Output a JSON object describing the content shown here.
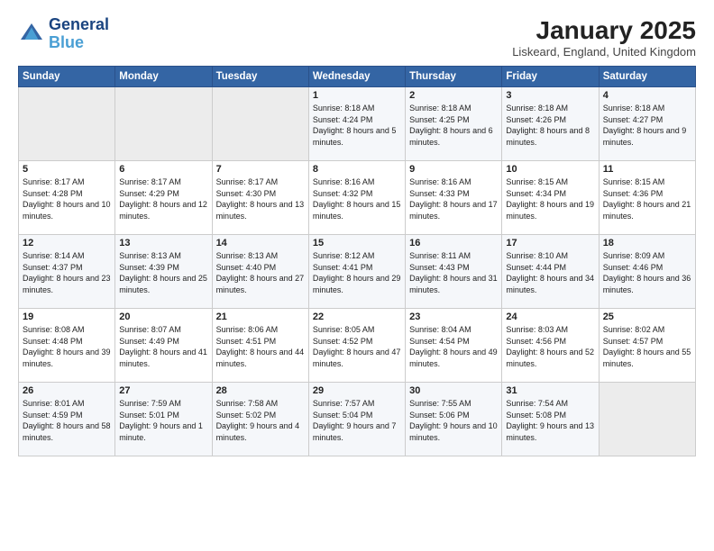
{
  "header": {
    "logo_line1": "General",
    "logo_line2": "Blue",
    "month": "January 2025",
    "location": "Liskeard, England, United Kingdom"
  },
  "weekdays": [
    "Sunday",
    "Monday",
    "Tuesday",
    "Wednesday",
    "Thursday",
    "Friday",
    "Saturday"
  ],
  "weeks": [
    [
      {
        "day": "",
        "sunrise": "",
        "sunset": "",
        "daylight": ""
      },
      {
        "day": "",
        "sunrise": "",
        "sunset": "",
        "daylight": ""
      },
      {
        "day": "",
        "sunrise": "",
        "sunset": "",
        "daylight": ""
      },
      {
        "day": "1",
        "sunrise": "Sunrise: 8:18 AM",
        "sunset": "Sunset: 4:24 PM",
        "daylight": "Daylight: 8 hours and 5 minutes."
      },
      {
        "day": "2",
        "sunrise": "Sunrise: 8:18 AM",
        "sunset": "Sunset: 4:25 PM",
        "daylight": "Daylight: 8 hours and 6 minutes."
      },
      {
        "day": "3",
        "sunrise": "Sunrise: 8:18 AM",
        "sunset": "Sunset: 4:26 PM",
        "daylight": "Daylight: 8 hours and 8 minutes."
      },
      {
        "day": "4",
        "sunrise": "Sunrise: 8:18 AM",
        "sunset": "Sunset: 4:27 PM",
        "daylight": "Daylight: 8 hours and 9 minutes."
      }
    ],
    [
      {
        "day": "5",
        "sunrise": "Sunrise: 8:17 AM",
        "sunset": "Sunset: 4:28 PM",
        "daylight": "Daylight: 8 hours and 10 minutes."
      },
      {
        "day": "6",
        "sunrise": "Sunrise: 8:17 AM",
        "sunset": "Sunset: 4:29 PM",
        "daylight": "Daylight: 8 hours and 12 minutes."
      },
      {
        "day": "7",
        "sunrise": "Sunrise: 8:17 AM",
        "sunset": "Sunset: 4:30 PM",
        "daylight": "Daylight: 8 hours and 13 minutes."
      },
      {
        "day": "8",
        "sunrise": "Sunrise: 8:16 AM",
        "sunset": "Sunset: 4:32 PM",
        "daylight": "Daylight: 8 hours and 15 minutes."
      },
      {
        "day": "9",
        "sunrise": "Sunrise: 8:16 AM",
        "sunset": "Sunset: 4:33 PM",
        "daylight": "Daylight: 8 hours and 17 minutes."
      },
      {
        "day": "10",
        "sunrise": "Sunrise: 8:15 AM",
        "sunset": "Sunset: 4:34 PM",
        "daylight": "Daylight: 8 hours and 19 minutes."
      },
      {
        "day": "11",
        "sunrise": "Sunrise: 8:15 AM",
        "sunset": "Sunset: 4:36 PM",
        "daylight": "Daylight: 8 hours and 21 minutes."
      }
    ],
    [
      {
        "day": "12",
        "sunrise": "Sunrise: 8:14 AM",
        "sunset": "Sunset: 4:37 PM",
        "daylight": "Daylight: 8 hours and 23 minutes."
      },
      {
        "day": "13",
        "sunrise": "Sunrise: 8:13 AM",
        "sunset": "Sunset: 4:39 PM",
        "daylight": "Daylight: 8 hours and 25 minutes."
      },
      {
        "day": "14",
        "sunrise": "Sunrise: 8:13 AM",
        "sunset": "Sunset: 4:40 PM",
        "daylight": "Daylight: 8 hours and 27 minutes."
      },
      {
        "day": "15",
        "sunrise": "Sunrise: 8:12 AM",
        "sunset": "Sunset: 4:41 PM",
        "daylight": "Daylight: 8 hours and 29 minutes."
      },
      {
        "day": "16",
        "sunrise": "Sunrise: 8:11 AM",
        "sunset": "Sunset: 4:43 PM",
        "daylight": "Daylight: 8 hours and 31 minutes."
      },
      {
        "day": "17",
        "sunrise": "Sunrise: 8:10 AM",
        "sunset": "Sunset: 4:44 PM",
        "daylight": "Daylight: 8 hours and 34 minutes."
      },
      {
        "day": "18",
        "sunrise": "Sunrise: 8:09 AM",
        "sunset": "Sunset: 4:46 PM",
        "daylight": "Daylight: 8 hours and 36 minutes."
      }
    ],
    [
      {
        "day": "19",
        "sunrise": "Sunrise: 8:08 AM",
        "sunset": "Sunset: 4:48 PM",
        "daylight": "Daylight: 8 hours and 39 minutes."
      },
      {
        "day": "20",
        "sunrise": "Sunrise: 8:07 AM",
        "sunset": "Sunset: 4:49 PM",
        "daylight": "Daylight: 8 hours and 41 minutes."
      },
      {
        "day": "21",
        "sunrise": "Sunrise: 8:06 AM",
        "sunset": "Sunset: 4:51 PM",
        "daylight": "Daylight: 8 hours and 44 minutes."
      },
      {
        "day": "22",
        "sunrise": "Sunrise: 8:05 AM",
        "sunset": "Sunset: 4:52 PM",
        "daylight": "Daylight: 8 hours and 47 minutes."
      },
      {
        "day": "23",
        "sunrise": "Sunrise: 8:04 AM",
        "sunset": "Sunset: 4:54 PM",
        "daylight": "Daylight: 8 hours and 49 minutes."
      },
      {
        "day": "24",
        "sunrise": "Sunrise: 8:03 AM",
        "sunset": "Sunset: 4:56 PM",
        "daylight": "Daylight: 8 hours and 52 minutes."
      },
      {
        "day": "25",
        "sunrise": "Sunrise: 8:02 AM",
        "sunset": "Sunset: 4:57 PM",
        "daylight": "Daylight: 8 hours and 55 minutes."
      }
    ],
    [
      {
        "day": "26",
        "sunrise": "Sunrise: 8:01 AM",
        "sunset": "Sunset: 4:59 PM",
        "daylight": "Daylight: 8 hours and 58 minutes."
      },
      {
        "day": "27",
        "sunrise": "Sunrise: 7:59 AM",
        "sunset": "Sunset: 5:01 PM",
        "daylight": "Daylight: 9 hours and 1 minute."
      },
      {
        "day": "28",
        "sunrise": "Sunrise: 7:58 AM",
        "sunset": "Sunset: 5:02 PM",
        "daylight": "Daylight: 9 hours and 4 minutes."
      },
      {
        "day": "29",
        "sunrise": "Sunrise: 7:57 AM",
        "sunset": "Sunset: 5:04 PM",
        "daylight": "Daylight: 9 hours and 7 minutes."
      },
      {
        "day": "30",
        "sunrise": "Sunrise: 7:55 AM",
        "sunset": "Sunset: 5:06 PM",
        "daylight": "Daylight: 9 hours and 10 minutes."
      },
      {
        "day": "31",
        "sunrise": "Sunrise: 7:54 AM",
        "sunset": "Sunset: 5:08 PM",
        "daylight": "Daylight: 9 hours and 13 minutes."
      },
      {
        "day": "",
        "sunrise": "",
        "sunset": "",
        "daylight": ""
      }
    ]
  ]
}
